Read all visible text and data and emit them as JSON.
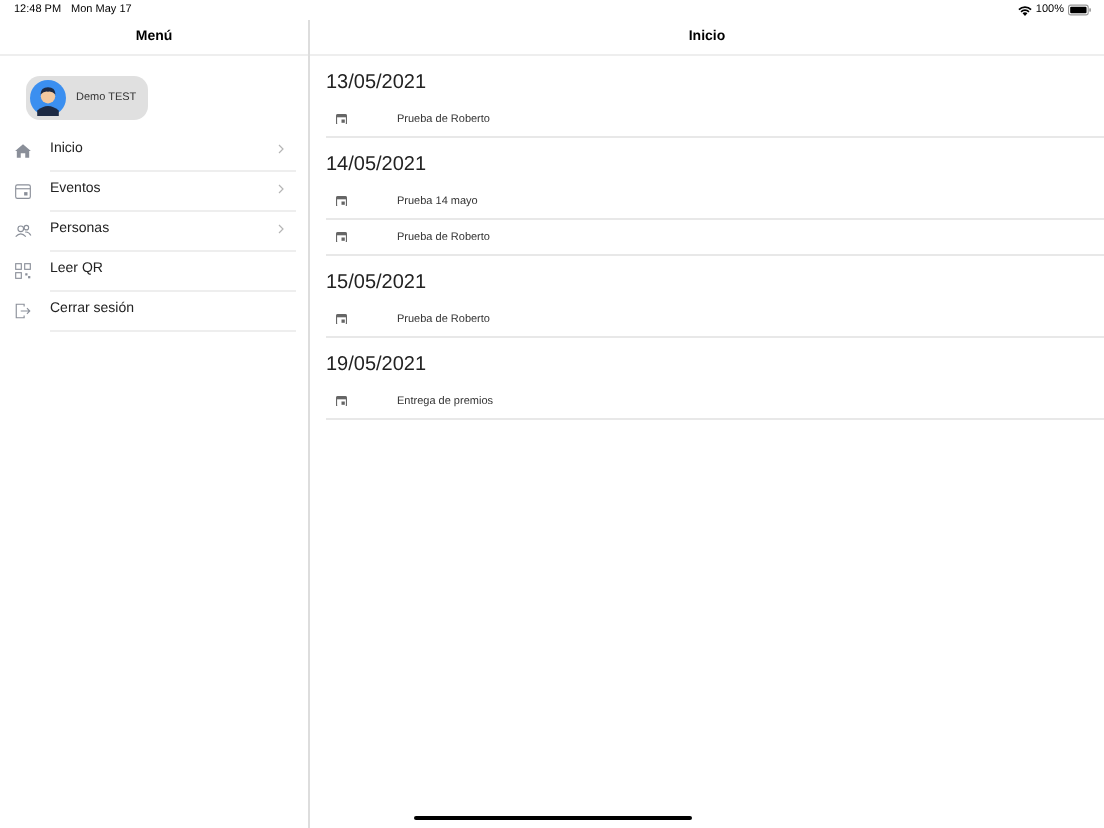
{
  "status_bar": {
    "time": "12:48 PM",
    "date": "Mon May 17",
    "battery": "100%"
  },
  "sidebar": {
    "title": "Menú",
    "profile": {
      "name": "Demo TEST"
    },
    "items": [
      {
        "label": "Inicio",
        "chevron": true
      },
      {
        "label": "Eventos",
        "chevron": true
      },
      {
        "label": "Personas",
        "chevron": true
      },
      {
        "label": "Leer QR",
        "chevron": false
      },
      {
        "label": "Cerrar sesión",
        "chevron": false
      }
    ]
  },
  "main": {
    "title": "Inicio",
    "groups": [
      {
        "date": "13/05/2021",
        "events": [
          {
            "name": "Prueba de Roberto"
          }
        ]
      },
      {
        "date": "14/05/2021",
        "events": [
          {
            "name": "Prueba 14 mayo"
          },
          {
            "name": "Prueba de Roberto"
          }
        ]
      },
      {
        "date": "15/05/2021",
        "events": [
          {
            "name": "Prueba de Roberto"
          }
        ]
      },
      {
        "date": "19/05/2021",
        "events": [
          {
            "name": "Entrega de premios"
          }
        ]
      }
    ]
  }
}
